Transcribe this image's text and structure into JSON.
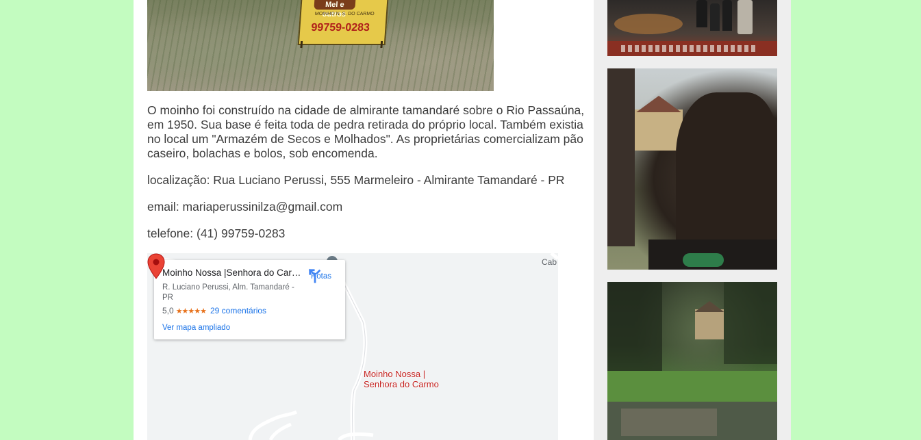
{
  "top_photo": {
    "sign": {
      "top_text": "Mel e outros",
      "line": "MOINHO N. S. DO CARMO",
      "phone": "99759-0283"
    }
  },
  "article": {
    "description": "O moinho foi construído na cidade de almirante tamandaré sobre o Rio Passaúna, em 1950. Sua base é feita toda de pedra retirada do próprio local. Também existia no local um \"Armazém de Secos e Molhados\". As proprietárias comercializam pão caseiro, bolachas e bolos, sob encomenda.",
    "location": "localização: Rua Luciano Perussi, 555 Marmeleiro - Almirante Tamandaré - PR",
    "email": "email: mariaperussinilza@gmail.com",
    "phone": "telefone: (41) 99759-0283"
  },
  "map": {
    "place_name": "Moinho Nossa |Senhora do Carmo",
    "address": "R. Luciano Perussi, Alm. Tamandaré - PR",
    "rating": "5,0",
    "stars": "★★★★★",
    "reviews": "29 comentários",
    "larger_map_link": "Ver mapa ampliado",
    "directions_label": "Rotas",
    "pin_label_line1": "Moinho Nossa |",
    "pin_label_line2": "Senhora do Carmo",
    "area_label": "Cab",
    "colors": {
      "link": "#1a73e8",
      "stars": "#e7711b",
      "pin": "#ea4335"
    }
  },
  "colors": {
    "page_background": "#c3fcc0",
    "content_background": "#ffffff",
    "sidebar_background": "#eeeeee",
    "text": "#3c3c3c"
  }
}
